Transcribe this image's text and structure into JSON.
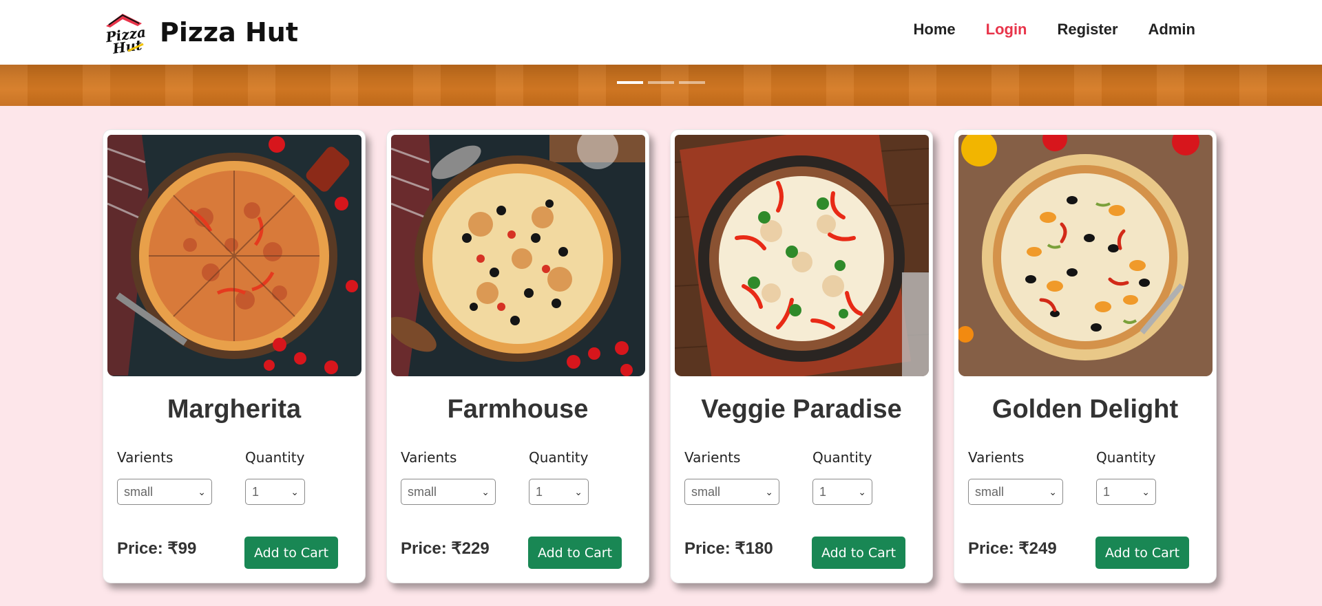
{
  "brand": {
    "logo_text_top": "Pizza",
    "logo_text_bottom": "Hut",
    "name": "Pizza Hut",
    "icon": "pizza-hut-logo-icon",
    "accent": "#e8344a"
  },
  "nav": {
    "items": [
      {
        "label": "Home",
        "active": false
      },
      {
        "label": "Login",
        "active": true
      },
      {
        "label": "Register",
        "active": false
      },
      {
        "label": "Admin",
        "active": false
      }
    ]
  },
  "banner": {
    "slides": 3,
    "active_slide": 0
  },
  "labels": {
    "variants": "Varients",
    "quantity": "Quantity",
    "price_prefix": "Price:",
    "currency": "₹",
    "add_to_cart": "Add to Cart"
  },
  "pizzas": [
    {
      "name": "Margherita",
      "variant": "small",
      "quantity": "1",
      "price": "99"
    },
    {
      "name": "Farmhouse",
      "variant": "small",
      "quantity": "1",
      "price": "229"
    },
    {
      "name": "Veggie Paradise",
      "variant": "small",
      "quantity": "1",
      "price": "180"
    },
    {
      "name": "Golden Delight",
      "variant": "small",
      "quantity": "1",
      "price": "249"
    }
  ],
  "colors": {
    "background": "#fde6ea",
    "button": "#198754",
    "banner": "#cc7420"
  }
}
